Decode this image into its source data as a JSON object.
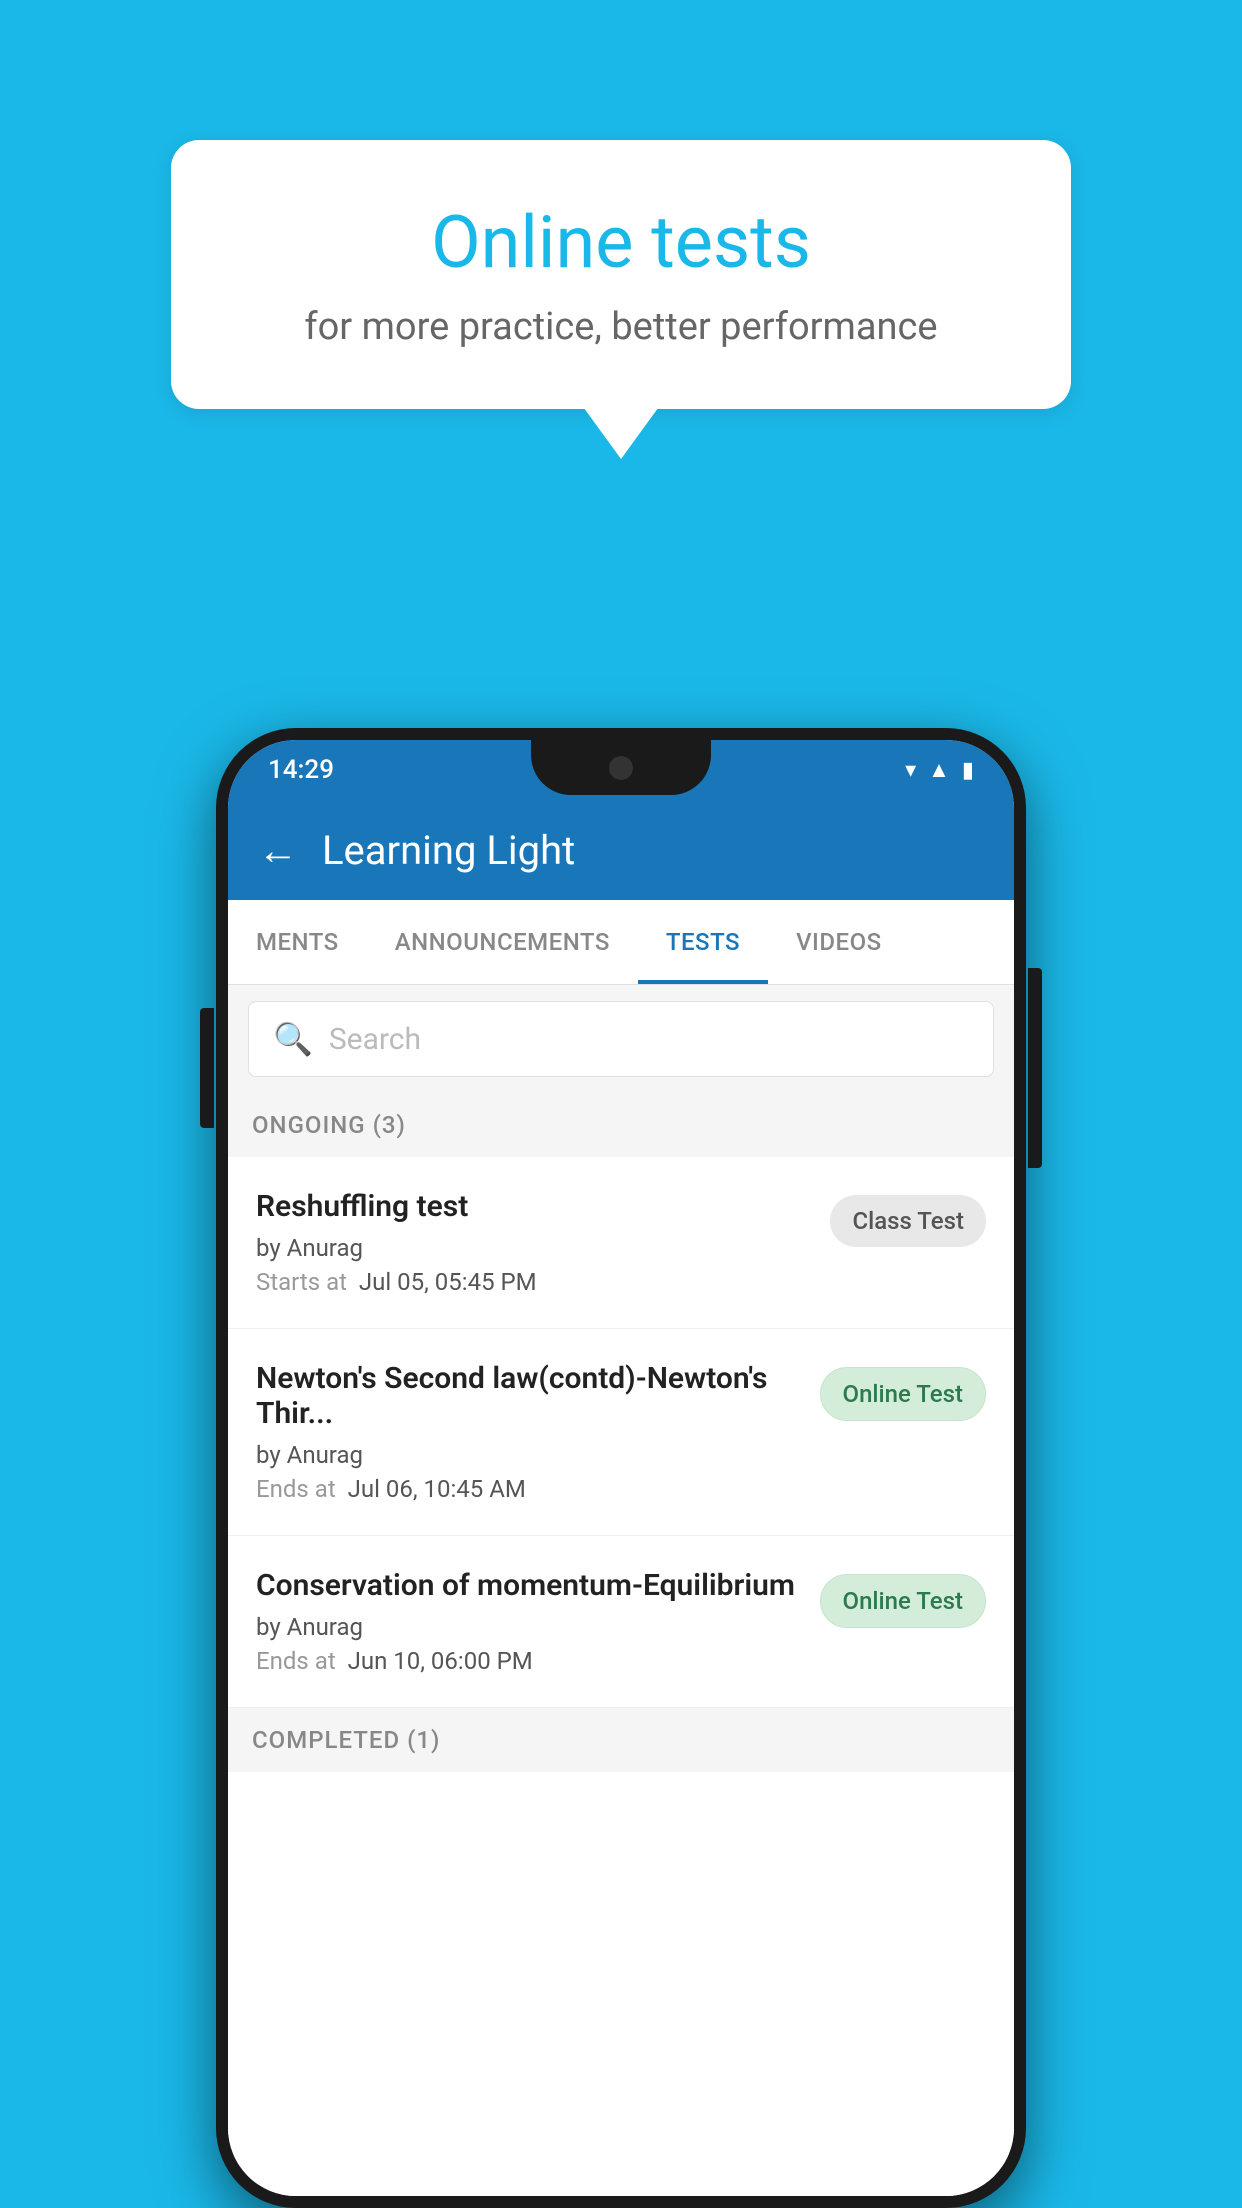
{
  "background_color": "#1ab8e8",
  "bubble": {
    "title": "Online tests",
    "subtitle": "for more practice, better performance"
  },
  "phone": {
    "status_bar": {
      "time": "14:29",
      "icons": [
        "wifi",
        "signal",
        "battery"
      ]
    },
    "app_bar": {
      "title": "Learning Light",
      "back_label": "←"
    },
    "tabs": [
      {
        "label": "MENTS",
        "active": false
      },
      {
        "label": "ANNOUNCEMENTS",
        "active": false
      },
      {
        "label": "TESTS",
        "active": true
      },
      {
        "label": "VIDEOS",
        "active": false
      }
    ],
    "search": {
      "placeholder": "Search"
    },
    "ongoing_section": {
      "label": "ONGOING (3)"
    },
    "test_items": [
      {
        "name": "Reshuffling test",
        "author": "by Anurag",
        "time_label": "Starts at",
        "time_value": "Jul 05, 05:45 PM",
        "badge": "Class Test",
        "badge_type": "class"
      },
      {
        "name": "Newton's Second law(contd)-Newton's Thir...",
        "author": "by Anurag",
        "time_label": "Ends at",
        "time_value": "Jul 06, 10:45 AM",
        "badge": "Online Test",
        "badge_type": "online"
      },
      {
        "name": "Conservation of momentum-Equilibrium",
        "author": "by Anurag",
        "time_label": "Ends at",
        "time_value": "Jun 10, 06:00 PM",
        "badge": "Online Test",
        "badge_type": "online"
      }
    ],
    "completed_section": {
      "label": "COMPLETED (1)"
    }
  }
}
